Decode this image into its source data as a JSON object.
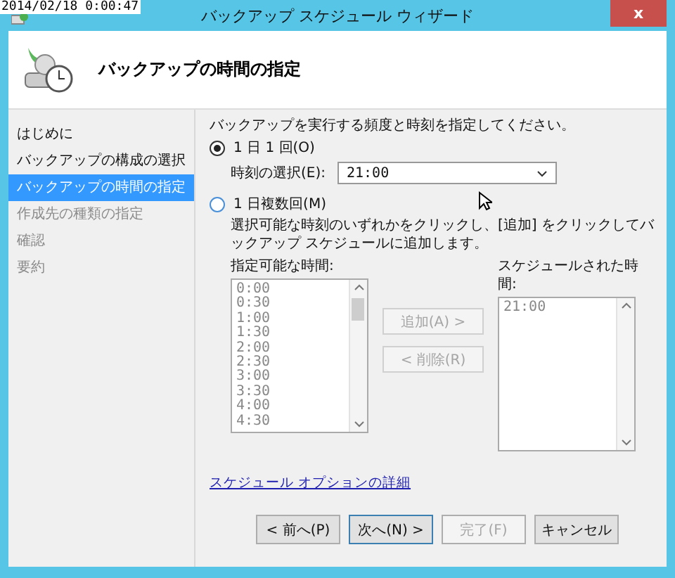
{
  "timestamp": "2014/02/18 0:00:47",
  "window": {
    "title": "バックアップ スケジュール ウィザード",
    "close": "x"
  },
  "header": {
    "title": "バックアップの時間の指定"
  },
  "steps": [
    {
      "label": "はじめに",
      "selected": false,
      "disabled": false
    },
    {
      "label": "バックアップの構成の選択",
      "selected": false,
      "disabled": false
    },
    {
      "label": "バックアップの時間の指定",
      "selected": true,
      "disabled": false
    },
    {
      "label": "作成先の種類の指定",
      "selected": false,
      "disabled": true
    },
    {
      "label": "確認",
      "selected": false,
      "disabled": true
    },
    {
      "label": "要約",
      "selected": false,
      "disabled": true
    }
  ],
  "prompt": "バックアップを実行する頻度と時刻を指定してください。",
  "options": [
    {
      "label": "1 日 1 回(O)",
      "selected": true
    },
    {
      "label": "1 日複数回(M)",
      "selected": false
    }
  ],
  "time_select": {
    "label": "時刻の選択(E):",
    "value": "21:00"
  },
  "description": "選択可能な時刻のいずれかをクリックし、[追加] をクリックしてバックアップ スケジュールに追加します。",
  "available": {
    "label": "指定可能な時間:",
    "items": [
      "0:00",
      "0:30",
      "1:00",
      "1:30",
      "2:00",
      "2:30",
      "3:00",
      "3:30",
      "4:00",
      "4:30"
    ]
  },
  "scheduled": {
    "label": "スケジュールされた時間:",
    "items": [
      "21:00"
    ]
  },
  "move_buttons": [
    {
      "label": "追加(A) >",
      "disabled": true
    },
    {
      "label": "< 削除(R)",
      "disabled": true
    }
  ],
  "link": "スケジュール オプションの詳細",
  "buttons": [
    {
      "label": "< 前へ(P)",
      "disabled": false,
      "default": false
    },
    {
      "label": "次へ(N) >",
      "disabled": false,
      "default": true
    },
    {
      "label": "完了(F)",
      "disabled": true,
      "default": false
    },
    {
      "label": "キャンセル",
      "disabled": false,
      "default": false
    }
  ]
}
